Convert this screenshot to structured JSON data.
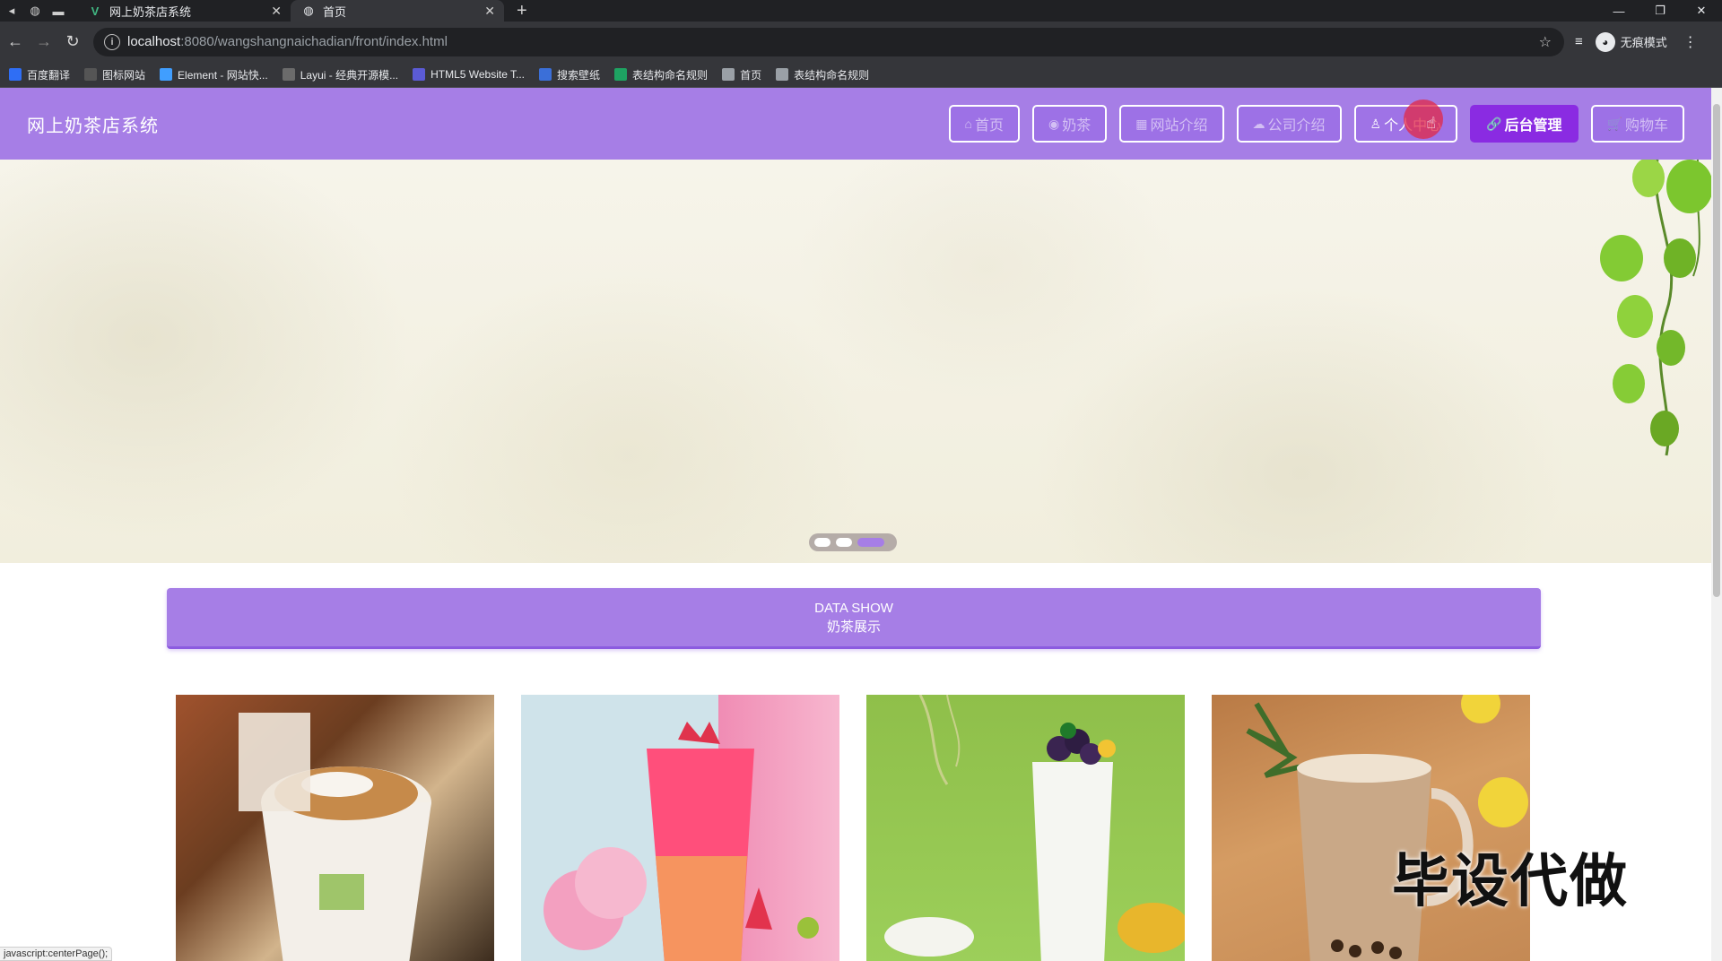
{
  "browser": {
    "tabs": [
      {
        "title": "网上奶茶店系统"
      },
      {
        "title": "首页"
      }
    ],
    "url_host": "localhost",
    "url_path": ":8080/wangshangnaichadian/front/index.html",
    "profile_label": "无痕模式",
    "bookmarks": [
      {
        "label": "百度翻译",
        "icon": "baidu-translate-icon",
        "color": "#2f6ef5"
      },
      {
        "label": "图标网站",
        "icon": "flag-icon",
        "color": "#555555"
      },
      {
        "label": "Element - 网站快...",
        "icon": "element-icon",
        "color": "#409eff"
      },
      {
        "label": "Layui - 经典开源模...",
        "icon": "layui-icon",
        "color": "#6b6b6b"
      },
      {
        "label": "HTML5 Website T...",
        "icon": "html5-template-icon",
        "color": "#5b5bd6"
      },
      {
        "label": "搜索壁纸",
        "icon": "wallpaper-icon",
        "color": "#3b6fd8"
      },
      {
        "label": "表结构命名规则",
        "icon": "sheet-icon",
        "color": "#1ea362"
      },
      {
        "label": "首页",
        "icon": "globe-icon",
        "color": "#9aa0a6"
      },
      {
        "label": "表结构命名规则",
        "icon": "globe-icon",
        "color": "#9aa0a6"
      }
    ],
    "status_text": "javascript:centerPage();"
  },
  "site": {
    "title": "网上奶茶店系统",
    "nav": [
      {
        "icon": "home-icon",
        "glyph": "⌂",
        "label": "首页"
      },
      {
        "icon": "milk-tea-icon",
        "glyph": "◉",
        "label": "奶茶"
      },
      {
        "icon": "site-intro-icon",
        "glyph": "▦",
        "label": "网站介绍"
      },
      {
        "icon": "company-icon",
        "glyph": "☁",
        "label": "公司介绍"
      },
      {
        "icon": "user-icon",
        "glyph": "♙",
        "label": "个人中心"
      },
      {
        "icon": "link-icon",
        "glyph": "🔗",
        "label": "后台管理"
      },
      {
        "icon": "cart-icon",
        "glyph": "🛒",
        "label": "购物车"
      }
    ],
    "banner": {
      "slide_count": 3,
      "active_slide": 3
    },
    "section": {
      "title_en": "DATA SHOW",
      "title_cn": "奶茶展示"
    },
    "watermark": "毕设代做",
    "colors": {
      "header": "#a67ee6",
      "admin_button": "#8a2be2"
    }
  }
}
